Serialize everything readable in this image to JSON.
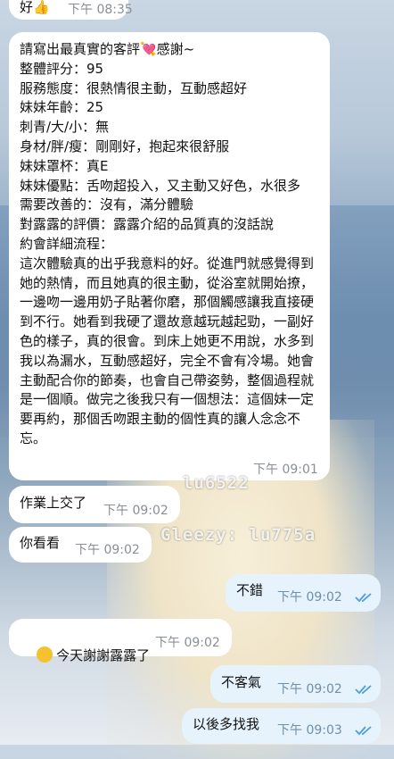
{
  "messages": [
    {
      "text": "好👍",
      "time": "下午 08:35"
    },
    {
      "text": "請寫出最真實的客評💘感謝~\n整體評分：95\n服務態度：很熱情很主動，互動感超好\n妹妹年齡：25\n刺青/大/小：無\n身材/胖/瘦：剛剛好，抱起來很舒服\n妹妹罩杯：真E\n妹妹優點：舌吻超投入，又主動又好色，水很多\n需要改善的：沒有，滿分體驗\n對露露的評價：露露介紹的品質真的沒話說\n約會詳細流程：\n這次體驗真的出乎我意料的好。從進門就感覺得到她的熱情，而且她真的很主動，從浴室就開始撩，一邊吻一邊用奶子貼著你磨，那個觸感讓我直接硬到不行。她看到我硬了還故意越玩越起勁，一副好色的樣子，真的很會。到床上她更不用說，水多到我以為漏水，互動感超好，完全不會有冷場。她會主動配合你的節奏，也會自己帶姿勢，整個過程就是一個順。做完之後我只有一個想法：這個妹一定要再約，那個舌吻跟主動的個性真的讓人念念不忘。",
      "time": "下午 09:01"
    },
    {
      "text": "作業上交了",
      "time": "下午 09:02"
    },
    {
      "text": "你看看",
      "time": "下午 09:02"
    },
    {
      "text": "不錯",
      "time": "下午 09:02"
    },
    {
      "text": "今天謝謝露露了",
      "emoji": "shushing-face-icon",
      "time": "下午 09:02"
    },
    {
      "text": "不客氣",
      "time": "下午 09:02"
    },
    {
      "text": "以後多找我",
      "time": "下午 09:03"
    }
  ],
  "watermarks": [
    "lu6522",
    "Gleezy: lu775a"
  ],
  "colors": {
    "incoming": "#ffffff",
    "outgoing": "#e6f2fc",
    "read_check": "#4f9fd8",
    "emoji": "#f5c12e"
  }
}
